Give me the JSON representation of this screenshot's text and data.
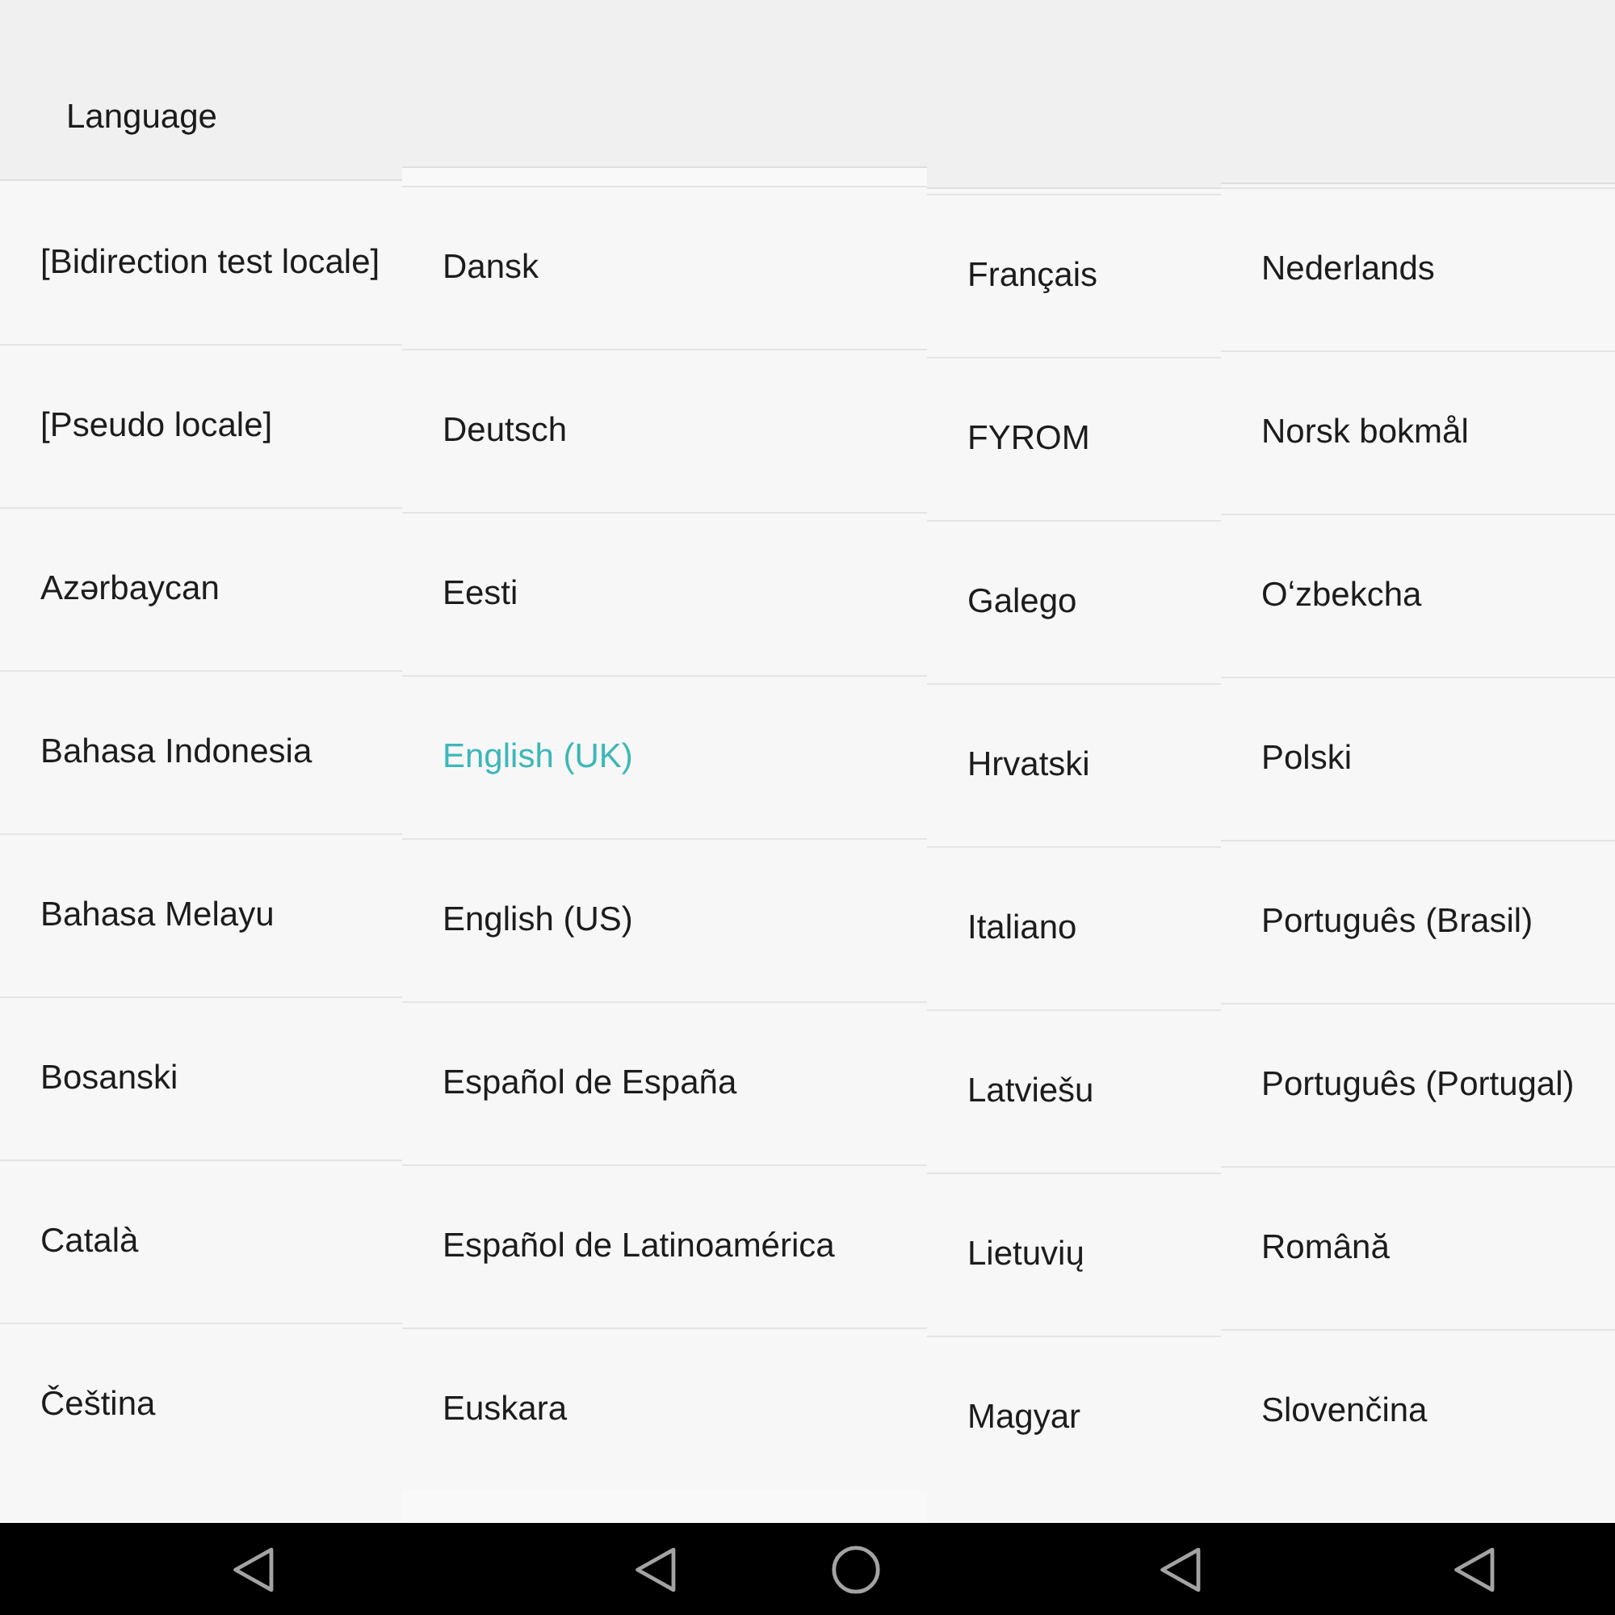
{
  "panels": [
    {
      "title": "Language",
      "items": [
        {
          "label": "[Bidirection test locale]",
          "selected": false
        },
        {
          "label": "[Pseudo locale]",
          "selected": false
        },
        {
          "label": "Azərbaycan",
          "selected": false
        },
        {
          "label": "Bahasa Indonesia",
          "selected": false
        },
        {
          "label": "Bahasa Melayu",
          "selected": false
        },
        {
          "label": "Bosanski",
          "selected": false
        },
        {
          "label": "Català",
          "selected": false
        },
        {
          "label": "Čeština",
          "selected": false
        }
      ],
      "nav_buttons": [
        {
          "kind": "back"
        }
      ]
    },
    {
      "items": [
        {
          "label": "Dansk",
          "selected": false
        },
        {
          "label": "Deutsch",
          "selected": false
        },
        {
          "label": "Eesti",
          "selected": false
        },
        {
          "label": "English (UK)",
          "selected": true
        },
        {
          "label": "English (US)",
          "selected": false
        },
        {
          "label": "Español de España",
          "selected": false
        },
        {
          "label": "Español de Latinoamérica",
          "selected": false
        },
        {
          "label": "Euskara",
          "selected": false
        }
      ],
      "nav_buttons": [
        {
          "kind": "back"
        },
        {
          "kind": "home"
        }
      ]
    },
    {
      "items": [
        {
          "label": "Français",
          "selected": false
        },
        {
          "label": "FYROM",
          "selected": false
        },
        {
          "label": "Galego",
          "selected": false
        },
        {
          "label": "Hrvatski",
          "selected": false
        },
        {
          "label": "Italiano",
          "selected": false
        },
        {
          "label": "Latviešu",
          "selected": false
        },
        {
          "label": "Lietuvių",
          "selected": false
        },
        {
          "label": "Magyar",
          "selected": false
        }
      ],
      "nav_buttons": [
        {
          "kind": "back"
        }
      ]
    },
    {
      "items": [
        {
          "label": "Nederlands",
          "selected": false
        },
        {
          "label": "Norsk bokmål",
          "selected": false
        },
        {
          "label": "Oʻzbekcha",
          "selected": false
        },
        {
          "label": "Polski",
          "selected": false
        },
        {
          "label": "Português (Brasil)",
          "selected": false
        },
        {
          "label": "Português (Portugal)",
          "selected": false
        },
        {
          "label": "Română",
          "selected": false
        },
        {
          "label": "Slovenčina",
          "selected": false
        }
      ],
      "nav_buttons": [
        {
          "kind": "back"
        }
      ]
    }
  ]
}
